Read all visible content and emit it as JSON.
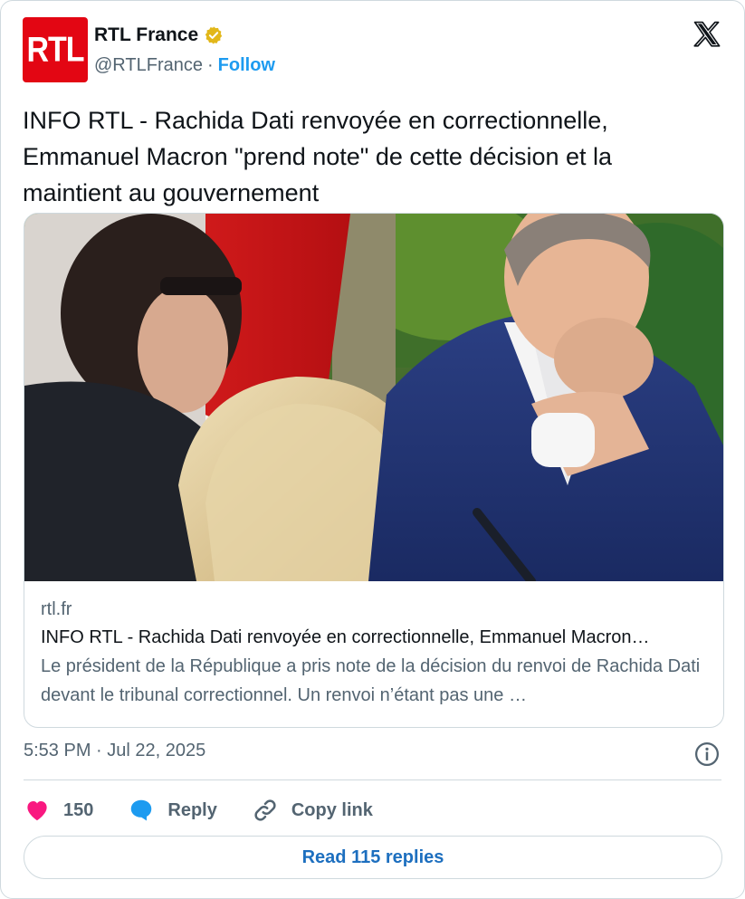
{
  "account": {
    "avatar_text": "RTL",
    "display_name": "RTL France",
    "handle": "@RTLFrance",
    "separator": "·",
    "follow_label": "Follow",
    "brand_color": "#e30613",
    "verified_color": "#e2b719"
  },
  "tweet": {
    "text": "INFO RTL - Rachida Dati renvoyée en correctionnelle, Emmanuel Macron \"prend note\" de cette décision et la maintient au gouvernement",
    "timestamp": "5:53 PM · Jul 22, 2025"
  },
  "link_card": {
    "domain": "rtl.fr",
    "title": "INFO RTL - Rachida Dati renvoyée en correctionnelle, Emmanuel Macron…",
    "description": "Le président de la République a pris note de la décision du renvoi de Rachida Dati devant le tribunal correctionnel. Un renvoi n’étant pas une …"
  },
  "actions": {
    "like_count": "150",
    "reply_label": "Reply",
    "copy_link_label": "Copy link",
    "like_color": "#f91880",
    "reply_color": "#1d9bf0"
  },
  "footer": {
    "read_replies_label": "Read 115 replies"
  },
  "icons": {
    "platform": "x-logo-icon",
    "info": "info-icon",
    "like": "heart-icon",
    "reply": "speech-bubble-icon",
    "copy": "link-icon",
    "verified": "verified-badge-icon"
  }
}
